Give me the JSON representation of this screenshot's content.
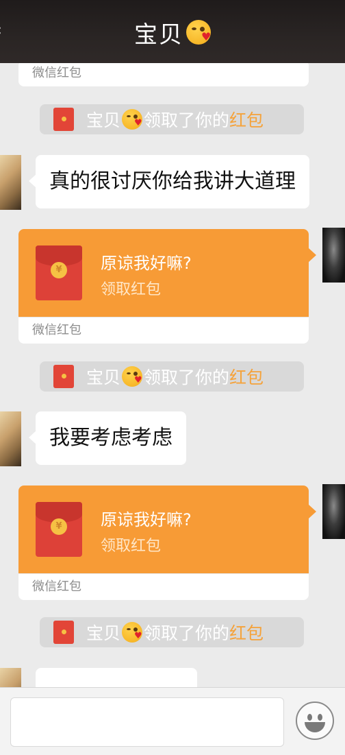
{
  "header": {
    "title": "宝贝",
    "title_emoji": "kissing-face-with-heart"
  },
  "messages": [
    {
      "type": "redpacket_footer",
      "footer": "微信红包"
    },
    {
      "type": "notice",
      "name": "宝贝",
      "action": "领取了你的",
      "highlight": "红包"
    },
    {
      "type": "text",
      "side": "left",
      "text": "真的很讨厌你给我讲大道理"
    },
    {
      "type": "redpacket",
      "side": "right",
      "title": "原谅我好嘛?",
      "subtitle": "领取红包",
      "footer": "微信红包"
    },
    {
      "type": "notice",
      "name": "宝贝",
      "action": "领取了你的",
      "highlight": "红包"
    },
    {
      "type": "text",
      "side": "left",
      "text": "我要考虑考虑"
    },
    {
      "type": "redpacket",
      "side": "right",
      "title": "原谅我好嘛?",
      "subtitle": "领取红包",
      "footer": "微信红包"
    },
    {
      "type": "notice",
      "name": "宝贝",
      "action": "领取了你的",
      "highlight": "红包"
    },
    {
      "type": "text",
      "side": "left",
      "text": "",
      "note": ""
    }
  ],
  "input": {
    "placeholder": ""
  },
  "icons": {
    "emoji_button": "smiley-face-icon"
  },
  "colors": {
    "redpacket_orange": "#f79b36",
    "notice_highlight": "#f5a23a",
    "chat_bg": "#ebebeb",
    "header_bg": "#2a2524"
  }
}
